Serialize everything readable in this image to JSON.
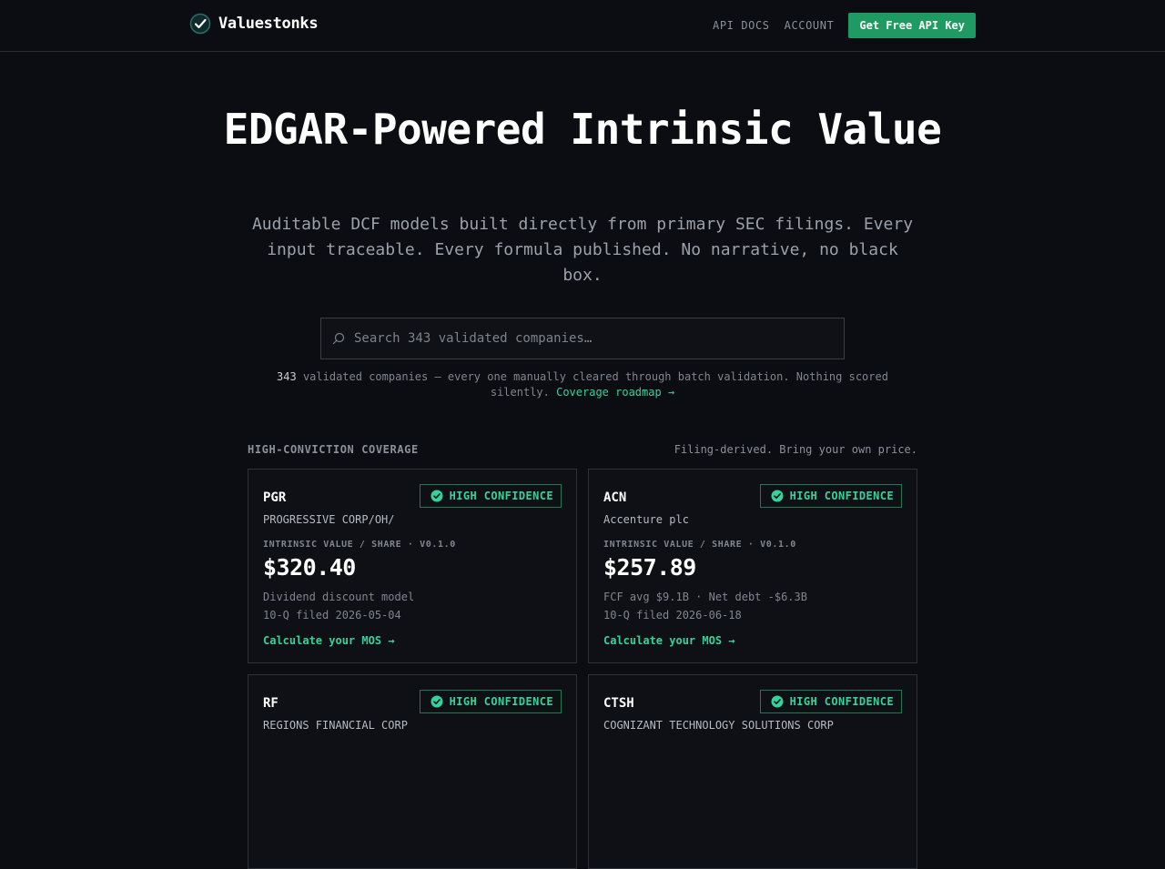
{
  "nav": {
    "brand": "Valuestonks",
    "links": [
      "API DOCS",
      "ACCOUNT"
    ],
    "cta": "Get Free API Key"
  },
  "hero": {
    "title": "EDGAR-Powered Intrinsic Value",
    "subtitle": "Auditable DCF models built directly from primary SEC filings. Every input traceable. Every formula published. No narrative, no black box."
  },
  "search": {
    "placeholder": "Search 343 validated companies…"
  },
  "coverage_note": {
    "count": "343",
    "text": "validated companies — every one manually cleared through batch validation. Nothing scored silently.",
    "link": "Coverage roadmap →"
  },
  "section": {
    "label": "HIGH-CONVICTION COVERAGE",
    "note": "Filing-derived. Bring your own price."
  },
  "cards": [
    {
      "ticker": "PGR",
      "badge": "HIGH CONFIDENCE",
      "company": "PROGRESSIVE CORP/OH/",
      "iv_label": "INTRINSIC VALUE / SHARE · V0.1.0",
      "value": "$320.40",
      "detail_1": "Dividend discount model",
      "detail_2": "10-Q filed 2026-05-04",
      "link": "Calculate your MOS →"
    },
    {
      "ticker": "ACN",
      "badge": "HIGH CONFIDENCE",
      "company": "Accenture plc",
      "iv_label": "INTRINSIC VALUE / SHARE · V0.1.0",
      "value": "$257.89",
      "detail_1": "FCF avg $9.1B · Net debt -$6.3B",
      "detail_2": "10-Q filed 2026-06-18",
      "link": "Calculate your MOS →"
    },
    {
      "ticker": "RF",
      "badge": "HIGH CONFIDENCE",
      "company": "REGIONS FINANCIAL CORP"
    },
    {
      "ticker": "CTSH",
      "badge": "HIGH CONFIDENCE",
      "company": "COGNIZANT TECHNOLOGY SOLUTIONS CORP"
    }
  ],
  "colors": {
    "background": "#0c0d12",
    "accent": "#34d399",
    "cta_bg": "#1e9a62"
  }
}
